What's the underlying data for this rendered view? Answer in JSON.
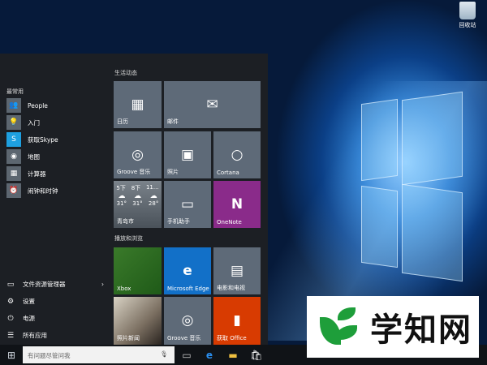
{
  "desktop": {
    "recycle_bin": "回收站"
  },
  "start_menu": {
    "most_used_label": "最常用",
    "most_used": [
      {
        "label": "People",
        "icon": "people-icon",
        "color": "#5c6670"
      },
      {
        "label": "入门",
        "icon": "lightbulb-icon",
        "color": "#5c6670"
      },
      {
        "label": "获取Skype",
        "icon": "skype-icon",
        "color": "#1ea0e0"
      },
      {
        "label": "地图",
        "icon": "maps-icon",
        "color": "#5c6670"
      },
      {
        "label": "计算器",
        "icon": "calculator-icon",
        "color": "#5c6670"
      },
      {
        "label": "闹钟和时钟",
        "icon": "alarm-icon",
        "color": "#5c6670"
      }
    ],
    "system": [
      {
        "label": "文件资源管理器",
        "icon": "file-explorer-icon",
        "chevron": "›"
      },
      {
        "label": "设置",
        "icon": "gear-icon"
      },
      {
        "label": "电源",
        "icon": "power-icon"
      },
      {
        "label": "所有应用",
        "icon": "list-icon"
      }
    ],
    "group1": "生活动态",
    "group2": "播放和浏览",
    "tiles": {
      "calendar": "日历",
      "mail": "邮件",
      "groove": "Groove 音乐",
      "photos": "照片",
      "cortana": "Cortana",
      "weather": {
        "city": "青岛市",
        "days": [
          "5下",
          "8下",
          "11..."
        ],
        "temps": [
          "31°",
          "31°",
          "28°"
        ]
      },
      "phone": "手机助手",
      "onenote": "OneNote",
      "xbox": "Xbox",
      "edge": "Microsoft Edge",
      "movies": "电影和电视",
      "news": "照片新闻",
      "groove2": "Groove 音乐",
      "office": "获取 Office"
    }
  },
  "taskbar": {
    "search_placeholder": "有问题尽管问我"
  },
  "watermark": {
    "text": "学知网"
  },
  "colors": {
    "tile": "#5e6a78",
    "onenote": "#8a2b8a",
    "edge": "#1270c8",
    "office": "#d83b01",
    "xbox": "#107c10"
  }
}
